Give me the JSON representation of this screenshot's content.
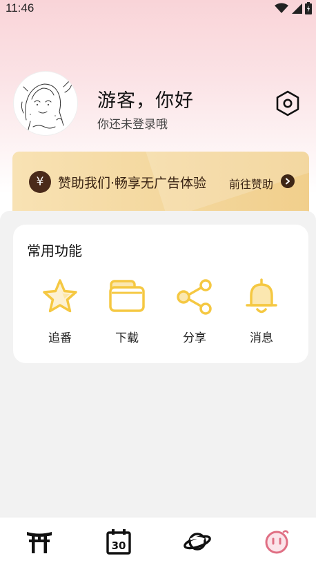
{
  "status_bar": {
    "time": "11:46"
  },
  "profile": {
    "greeting": "游客，你好",
    "login_hint": "你还未登录哦"
  },
  "sponsor": {
    "coin_symbol": "¥",
    "text": "赞助我们·畅享无广告体验",
    "link": "前往赞助"
  },
  "features": {
    "title": "常用功能",
    "items": [
      {
        "label": "追番",
        "icon": "star-icon"
      },
      {
        "label": "下载",
        "icon": "folder-icon"
      },
      {
        "label": "分享",
        "icon": "share-icon"
      },
      {
        "label": "消息",
        "icon": "bell-icon"
      }
    ]
  },
  "bottom_nav": {
    "items": [
      {
        "icon": "torii-gate-icon"
      },
      {
        "icon": "calendar-icon",
        "number": "30"
      },
      {
        "icon": "planet-icon"
      },
      {
        "icon": "smiley-face-icon"
      }
    ]
  },
  "colors": {
    "accent_yellow": "#f5c842",
    "sponsor_brown": "#3e2616",
    "profile_pink": "#e06f84"
  }
}
